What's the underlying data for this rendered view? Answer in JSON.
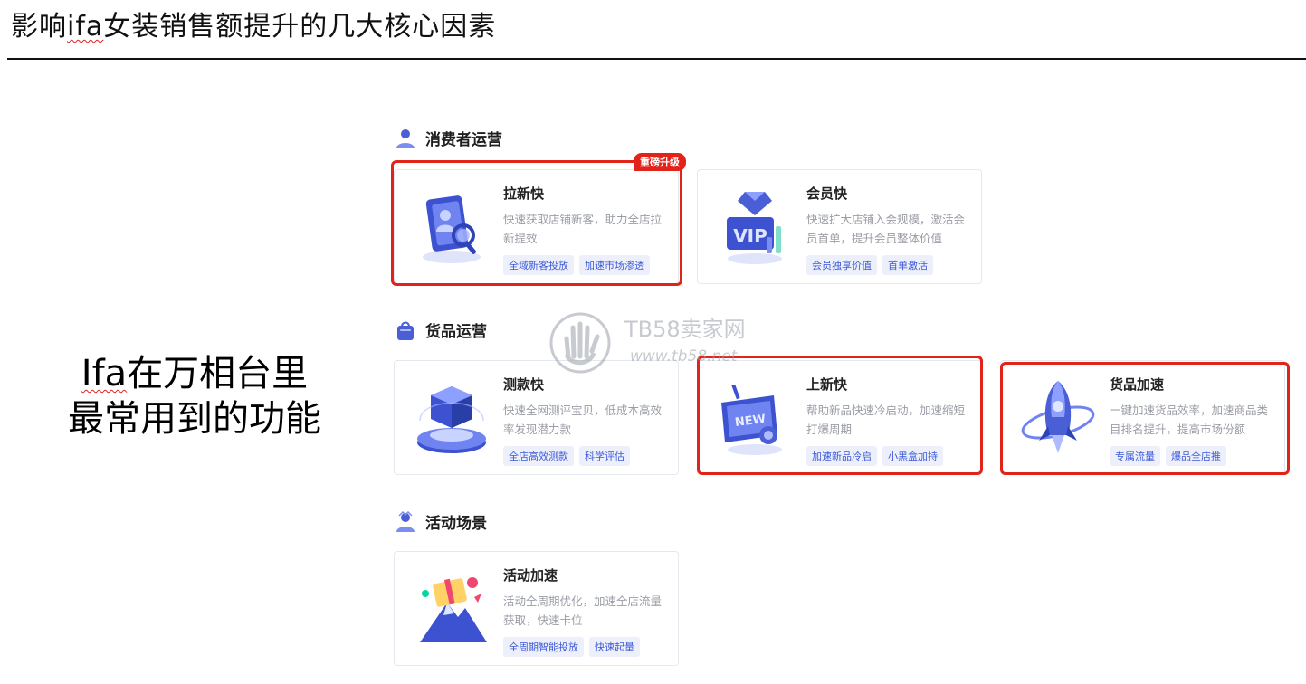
{
  "page": {
    "title_prefix": "影响",
    "title_brand": "ifa",
    "title_suffix": "女装销售额提升的几大核心因素",
    "caption_line1_brand": "Ifa",
    "caption_line1_rest": "在万相台里",
    "caption_line2": "最常用到的功能"
  },
  "watermark": {
    "brand": "TB58卖家网",
    "url": "www.tb58.net"
  },
  "colors": {
    "highlight": "#e2231a",
    "tag_text": "#3d5ad6",
    "tag_bg": "#edf0fb",
    "icon_blue": "#4a5fd6"
  },
  "sections": [
    {
      "label": "消费者运营",
      "icon": "person-icon",
      "cards": [
        {
          "name": "拉新快",
          "desc": "快速获取店铺新客，助力全店拉新提效",
          "tags": [
            "全域新客投放",
            "加速市场渗透"
          ],
          "badge": "重磅升级",
          "highlighted": true,
          "icon": "id-card-magnifier-icon"
        },
        {
          "name": "会员快",
          "desc": "快速扩大店铺入会规模，激活会员首单，提升会员整体价值",
          "tags": [
            "会员独享价值",
            "首单激活"
          ],
          "highlighted": false,
          "icon": "vip-diamond-icon"
        }
      ]
    },
    {
      "label": "货品运营",
      "icon": "shopping-bag-icon",
      "cards": [
        {
          "name": "测款快",
          "desc": "快速全网测评宝贝，低成本高效率发现潜力款",
          "tags": [
            "全店高效测款",
            "科学评估"
          ],
          "highlighted": false,
          "icon": "box-pedestal-icon"
        },
        {
          "name": "上新快",
          "desc": "帮助新品快速冷启动，加速缩短打爆周期",
          "tags": [
            "加速新品冷启",
            "小黑盒加持"
          ],
          "highlighted": true,
          "icon": "new-sign-icon"
        },
        {
          "name": "货品加速",
          "desc": "一键加速货品效率，加速商品类目排名提升，提高市场份额",
          "tags": [
            "专属流量",
            "爆品全店推"
          ],
          "highlighted": true,
          "icon": "rocket-icon"
        }
      ]
    },
    {
      "label": "活动场景",
      "icon": "event-person-icon",
      "cards": [
        {
          "name": "活动加速",
          "desc": "活动全周期优化，加速全店流量获取，快速卡位",
          "tags": [
            "全周期智能投放",
            "快速起量"
          ],
          "highlighted": false,
          "icon": "gift-mountain-icon"
        }
      ]
    }
  ]
}
